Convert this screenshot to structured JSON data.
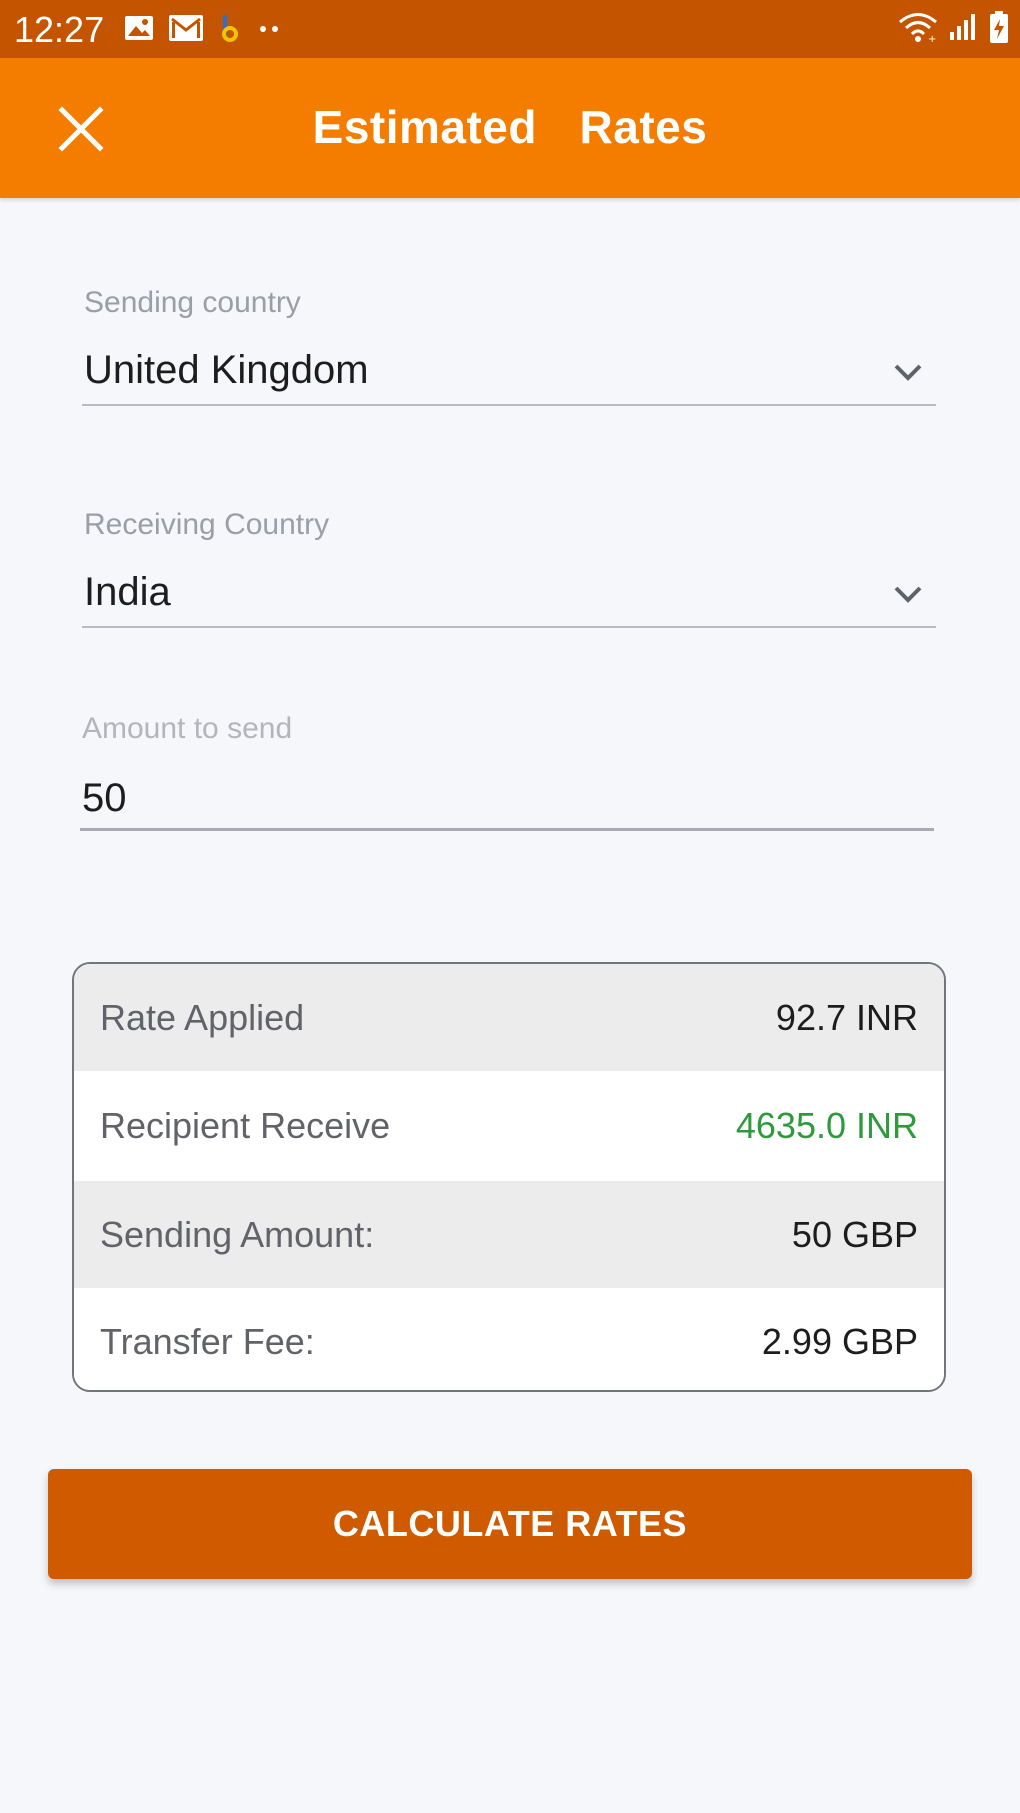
{
  "status_bar": {
    "time": "12:27",
    "left_icons": [
      "image-icon",
      "gmail-icon",
      "app-notification-icon",
      "more-dots-icon"
    ],
    "right_icons": [
      "wifi-icon",
      "signal-icon",
      "battery-charging-icon"
    ]
  },
  "app_bar": {
    "title": "Estimated  Rates",
    "close_icon": "close-icon"
  },
  "form": {
    "sending_country": {
      "label": "Sending country",
      "value": "United Kingdom"
    },
    "receiving_country": {
      "label": "Receiving Country",
      "value": "India"
    },
    "amount": {
      "label": "Amount to send",
      "value": "50"
    }
  },
  "rates": [
    {
      "label": "Rate Applied",
      "value": "92.7 INR"
    },
    {
      "label": "Recipient Receive",
      "value": "4635.0 INR"
    },
    {
      "label": "Sending Amount:",
      "value": "50 GBP"
    },
    {
      "label": "Transfer Fee:",
      "value": "2.99 GBP"
    }
  ],
  "colors": {
    "status_bar": "#c55400",
    "app_bar": "#f47d00",
    "button": "#cf5a00",
    "positive_value": "#2e9a3c"
  },
  "button": {
    "label": "CALCULATE RATES"
  }
}
